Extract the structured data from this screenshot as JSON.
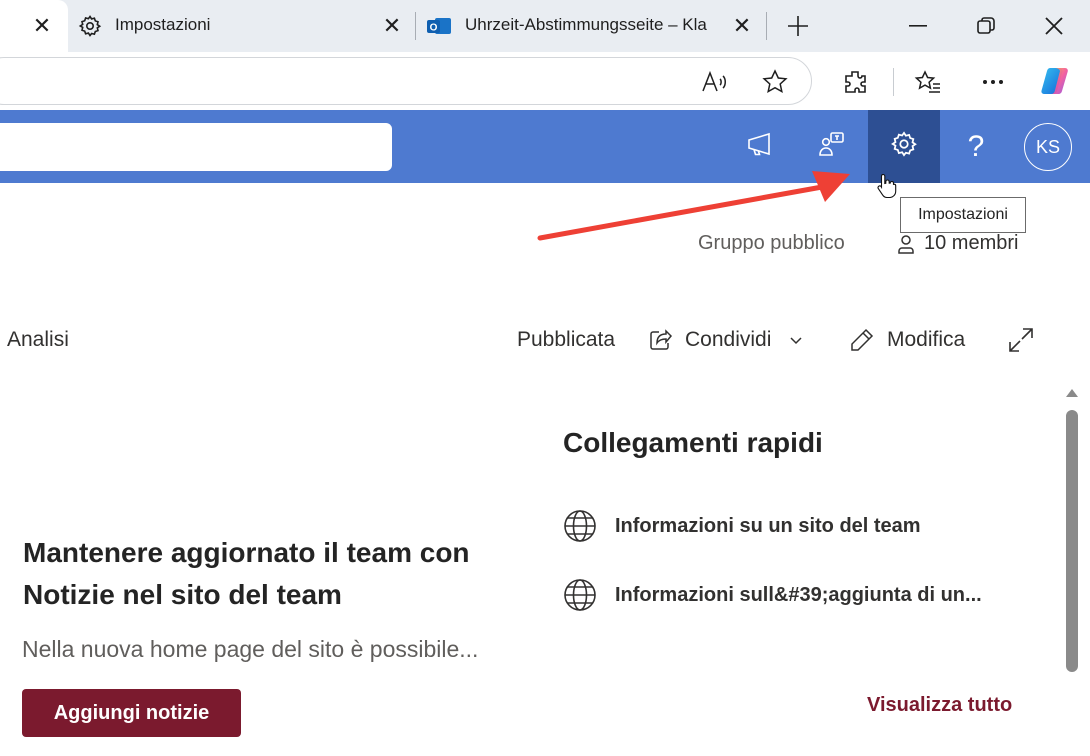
{
  "browser": {
    "tabs": [
      {
        "title": "Impostazioni",
        "close_icon": "close-icon"
      },
      {
        "title": "Uhrzeit-Abstimmungsseite – Kla",
        "close_icon": "close-icon"
      }
    ],
    "toolbar_icons": [
      "read-aloud-icon",
      "favorite-star-icon",
      "extensions-icon",
      "favorites-icon",
      "more-icon",
      "copilot-icon"
    ]
  },
  "suite_bar": {
    "icons": [
      "megaphone-icon",
      "teams-icon",
      "gear-icon",
      "help-icon"
    ],
    "help_glyph": "?",
    "avatar_initials": "KS"
  },
  "tooltip": {
    "text": "Impostazioni"
  },
  "site_header": {
    "visibility": "Gruppo pubblico",
    "members": "10 membri"
  },
  "command_bar": {
    "analytics": "Analisi",
    "status": "Pubblicata",
    "share": "Condividi",
    "edit": "Modifica"
  },
  "quick_links": {
    "title": "Collegamenti rapidi",
    "items": [
      {
        "label": "Informazioni su un sito del team",
        "icon": "globe-icon"
      },
      {
        "label": "Informazioni sull&#39;aggiunta di un...",
        "icon": "globe-icon"
      }
    ],
    "see_all": "Visualizza tutto"
  },
  "news": {
    "title": "Mantenere aggiornato il team con Notizie nel sito del team",
    "description": "Nella nuova home page del sito è possibile...",
    "button": "Aggiungi notizie"
  },
  "colors": {
    "suite_bar": "#4e7ad0",
    "settings_active": "#2d4f93",
    "brand_button": "#7b1a2e",
    "annotation_arrow": "#ee4035"
  }
}
